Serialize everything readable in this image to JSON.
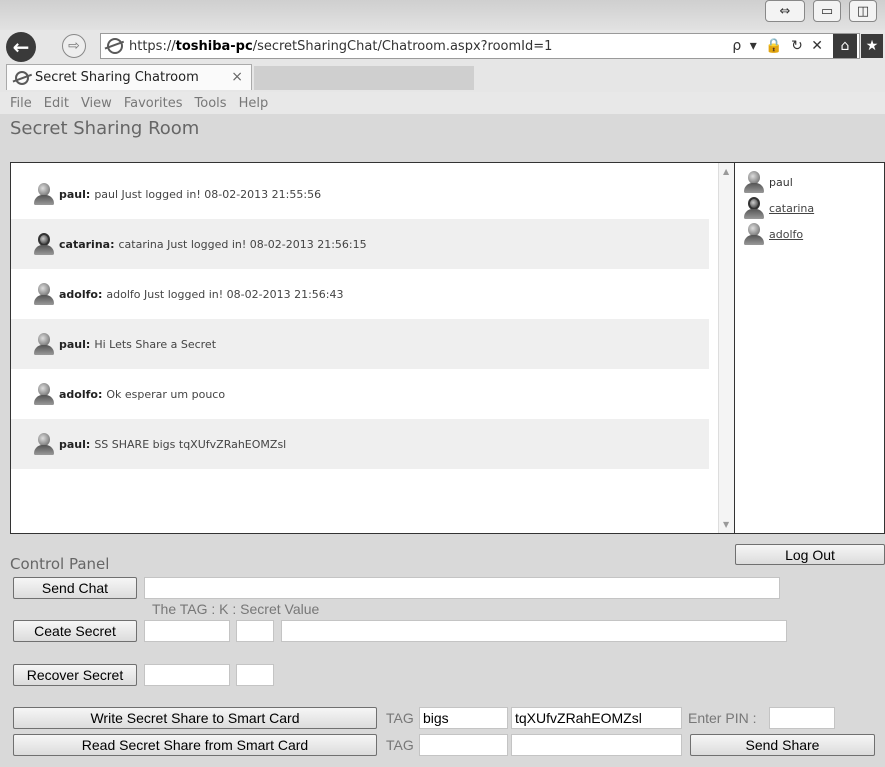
{
  "browser": {
    "url_prefix": "https://",
    "url_host": "toshiba-pc",
    "url_path": "/secretSharingChat/Chatroom.aspx?roomId=1",
    "tab_title": "Secret Sharing Chatroom",
    "tab_close": "×",
    "addr_tools": "ρ ▾ 🔒 ↻ ✕",
    "menu": [
      "File",
      "Edit",
      "View",
      "Favorites",
      "Tools",
      "Help"
    ]
  },
  "page": {
    "title": "Secret Sharing Room"
  },
  "messages": [
    {
      "user": "paul:",
      "text": "paul Just logged in! 08-02-2013 21:55:56",
      "avatar": "male",
      "alt": false
    },
    {
      "user": "catarina:",
      "text": "catarina Just logged in! 08-02-2013 21:56:15",
      "avatar": "female",
      "alt": true
    },
    {
      "user": "adolfo:",
      "text": "adolfo Just logged in! 08-02-2013 21:56:43",
      "avatar": "male",
      "alt": false
    },
    {
      "user": "paul:",
      "text": "Hi Lets Share a Secret",
      "avatar": "male",
      "alt": true
    },
    {
      "user": "adolfo:",
      "text": "Ok esperar um pouco",
      "avatar": "male",
      "alt": false
    },
    {
      "user": "paul:",
      "text": "SS SHARE bigs tqXUfvZRahEOMZsl",
      "avatar": "male",
      "alt": true
    }
  ],
  "users": [
    {
      "name": "paul",
      "avatar": "male",
      "link": false
    },
    {
      "name": "catarina",
      "avatar": "female",
      "link": true
    },
    {
      "name": "adolfo",
      "avatar": "male",
      "link": true
    }
  ],
  "control_panel": {
    "title": "Control Panel",
    "logout_label": "Log Out",
    "send_chat_label": "Send Chat",
    "send_chat_value": "",
    "secret_hint": "The TAG : K : Secret Value",
    "create_secret_label": "Ceate Secret",
    "recover_secret_label": "Recover Secret",
    "write_card_label": "Write Secret Share to Smart Card",
    "read_card_label": "Read Secret Share from Smart Card",
    "tag_label": "TAG",
    "write_tag_value": "bigs",
    "write_share_value": "tqXUfvZRahEOMZsl",
    "pin_label": "Enter PIN :",
    "send_share_label": "Send Share"
  }
}
